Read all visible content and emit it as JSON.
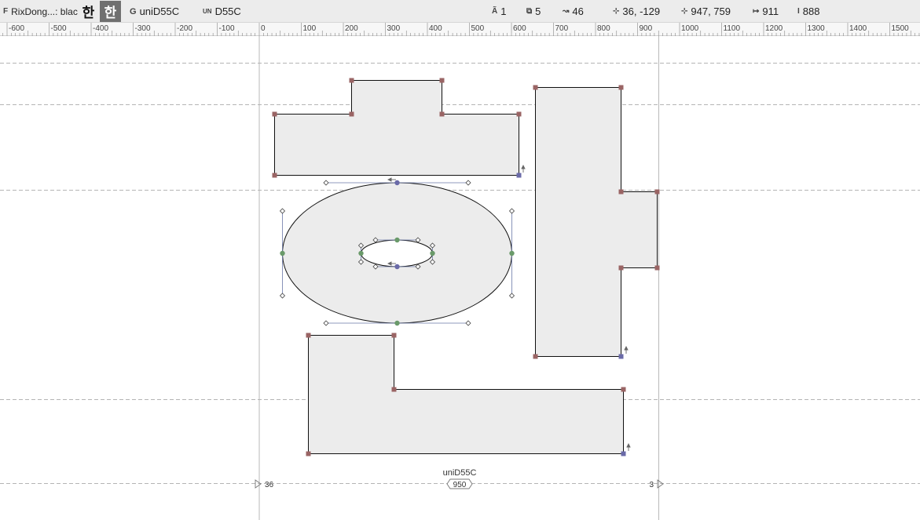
{
  "toolbar": {
    "font_icon": "F",
    "font_name": "RixDong...: black",
    "glyph_char": "한",
    "glyph_icon": "G",
    "glyph_name": "uniD55C",
    "unicode_icon": "UN",
    "unicode_value": "D55C",
    "layers_icon": "Ã",
    "layers_count": "1",
    "contours_icon": "⧉",
    "contours_count": "5",
    "nodes_icon": "↝",
    "nodes_count": "46",
    "origin_icon": "⊹",
    "origin_value": "36, -129",
    "size_icon": "⊹",
    "size_value": "947, 759",
    "width_icon": "↦",
    "width_value": "911",
    "height_icon": "I",
    "height_value": "888"
  },
  "ruler": {
    "labels": [
      "-600",
      "-500",
      "-400",
      "-300",
      "-200",
      "-100",
      "0",
      "100",
      "200",
      "300",
      "400",
      "500",
      "600",
      "700",
      "800",
      "900",
      "1000",
      "1100",
      "1200",
      "1300",
      "1400",
      "1500"
    ]
  },
  "canvas": {
    "glyph_label": "uniD55C",
    "advance_width": "950",
    "left_sidebearing": "36",
    "right_sidebearing": "3"
  },
  "colors": {
    "toolbar_bg": "#ececec",
    "glyph_fill": "#ececec",
    "corner_node": "#9a6464",
    "curve_node": "#6a9a6a",
    "start_node": "#6a6aa8",
    "guide_line": "#b4b4b4"
  }
}
